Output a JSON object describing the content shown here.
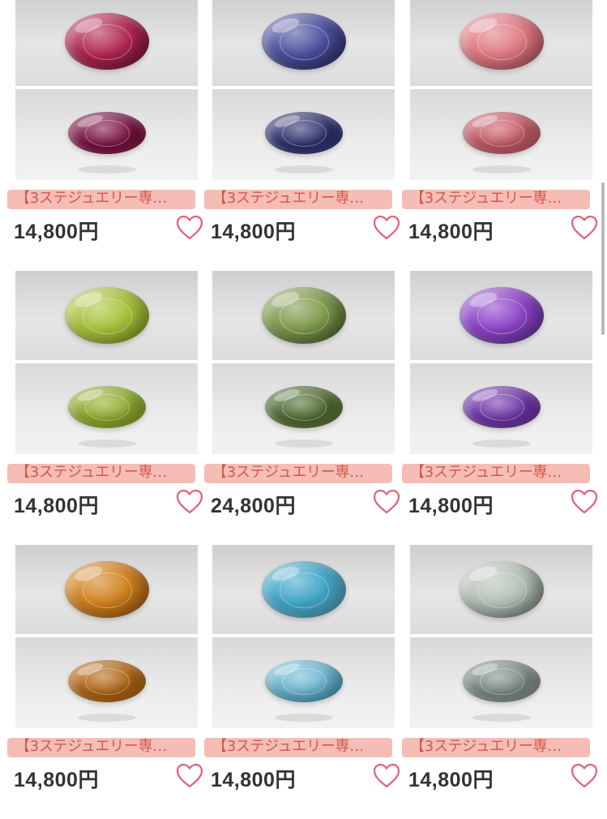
{
  "products": [
    {
      "title": "【3ステジュエリー専…",
      "price": "14,800円",
      "gem_color": "#b0264f",
      "gem_color_b": "#7a1040"
    },
    {
      "title": "【3ステジュエリー専…",
      "price": "14,800円",
      "gem_color": "#4a4f9e",
      "gem_color_b": "#2c2f6e"
    },
    {
      "title": "【3ステジュエリー専…",
      "price": "14,800円",
      "gem_color": "#e07a82",
      "gem_color_b": "#c85a66"
    },
    {
      "title": "【3ステジュエリー専…",
      "price": "14,800円",
      "gem_color": "#a8c23a",
      "gem_color_b": "#8fae2a"
    },
    {
      "title": "【3ステジュエリー専…",
      "price": "24,800円",
      "gem_color": "#7f9a4c",
      "gem_color_b": "#4e6a2f"
    },
    {
      "title": "【3ステジュエリー専…",
      "price": "14,800円",
      "gem_color": "#8c44c8",
      "gem_color_b": "#6d34a8"
    },
    {
      "title": "【3ステジュエリー専…",
      "price": "14,800円",
      "gem_color": "#d0801c",
      "gem_color_b": "#b26410"
    },
    {
      "title": "【3ステジュエリー専…",
      "price": "14,800円",
      "gem_color": "#3ea6c8",
      "gem_color_b": "#6ab8d4"
    },
    {
      "title": "【3ステジュエリー専…",
      "price": "14,800円",
      "gem_color": "#b4c2b8",
      "gem_color_b": "#7c8c84"
    }
  ],
  "colors": {
    "title_highlight": "#f4b2aa",
    "title_text": "#d2584a",
    "price_text": "#333333",
    "heart": "#e0607a"
  },
  "icons": {
    "favorite": "heart-outline-icon"
  }
}
